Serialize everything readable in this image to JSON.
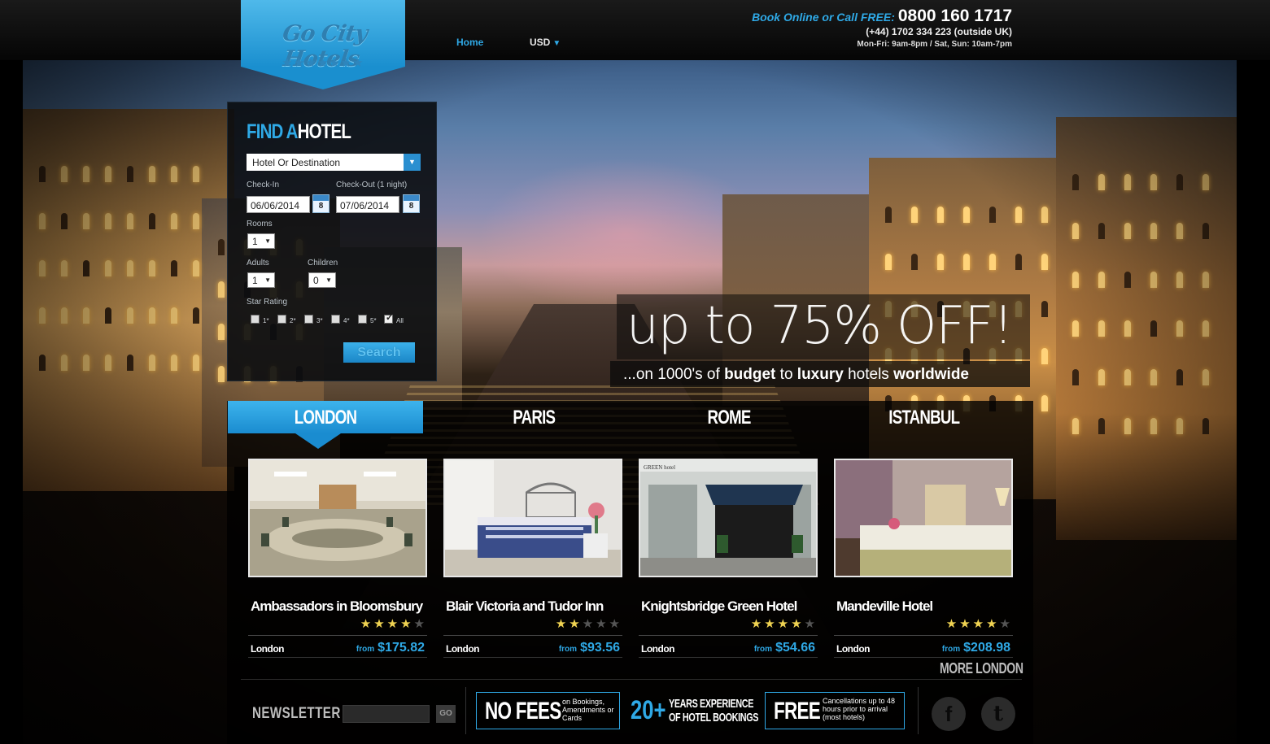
{
  "header": {
    "logo_text": "Go City Hotels",
    "logo_stars": "★★★★★★★",
    "nav": {
      "home": "Home",
      "currency": "USD",
      "currency_caret": "▼"
    },
    "contact": {
      "book_label": "Book Online or Call FREE:",
      "phone": "0800 160 1717",
      "intl_phone": "(+44) 1702 334 223 (outside UK)",
      "hours": "Mon-Fri: 9am-8pm / Sat, Sun: 10am-7pm"
    }
  },
  "finder": {
    "title_a": "FIND A",
    "title_b": "HOTEL",
    "destination_value": "Hotel Or Destination",
    "destination_caret": "▼",
    "checkin_label": "Check-In",
    "checkin_value": "06/06/2014",
    "checkout_label": "Check-Out (1 night)",
    "checkout_value": "07/06/2014",
    "calendar_day": "8",
    "rooms_label": "Rooms",
    "rooms_value": "1",
    "adults_label": "Adults",
    "adults_value": "1",
    "children_label": "Children",
    "children_value": "0",
    "select_caret": "▼",
    "star_label": "Star Rating",
    "star_options": [
      "1*",
      "2*",
      "3*",
      "4*",
      "5*",
      "All"
    ],
    "search_label": "Search"
  },
  "promo": {
    "headline": "up to 75% OFF!",
    "sub_prefix": "...on 1000's of ",
    "sub_b1": "budget",
    "sub_mid": " to ",
    "sub_b2": "luxury",
    "sub_mid2": " hotels ",
    "sub_b3": "worldwide"
  },
  "city_tabs": [
    "LONDON",
    "PARIS",
    "ROME",
    "ISTANBUL"
  ],
  "active_tab": "LONDON",
  "hotels": [
    {
      "name": "Ambassadors in Bloomsbury",
      "stars": 4,
      "max_stars": 5,
      "city": "London",
      "from": "from",
      "price": "$175.82"
    },
    {
      "name": "Blair Victoria and Tudor Inn",
      "stars": 2,
      "max_stars": 5,
      "city": "London",
      "from": "from",
      "price": "$93.56"
    },
    {
      "name": "Knightsbridge Green Hotel",
      "stars": 4,
      "max_stars": 5,
      "city": "London",
      "from": "from",
      "price": "$54.66"
    },
    {
      "name": "Mandeville Hotel",
      "stars": 4,
      "max_stars": 5,
      "city": "London",
      "from": "from",
      "price": "$208.98"
    }
  ],
  "photo_sign": "GREEN hotel",
  "more_link": "MORE LONDON",
  "footer": {
    "newsletter_label": "NEWSLETTER",
    "newsletter_go": "GO",
    "no_fees_big": "NO FEES",
    "no_fees_small": "on Bookings, Amendments or Cards",
    "years_num": "20+",
    "years_text_1": "YEARS EXPERIENCE",
    "years_text_2": "OF HOTEL BOOKINGS",
    "free_big": "FREE",
    "free_small": "Cancellations up to 48 hours prior to arrival (most hotels)",
    "facebook_glyph": "f",
    "twitter_glyph": "t"
  },
  "colors": {
    "accent": "#2fa9e6",
    "star_on": "#f0d352",
    "star_off": "#555555"
  }
}
